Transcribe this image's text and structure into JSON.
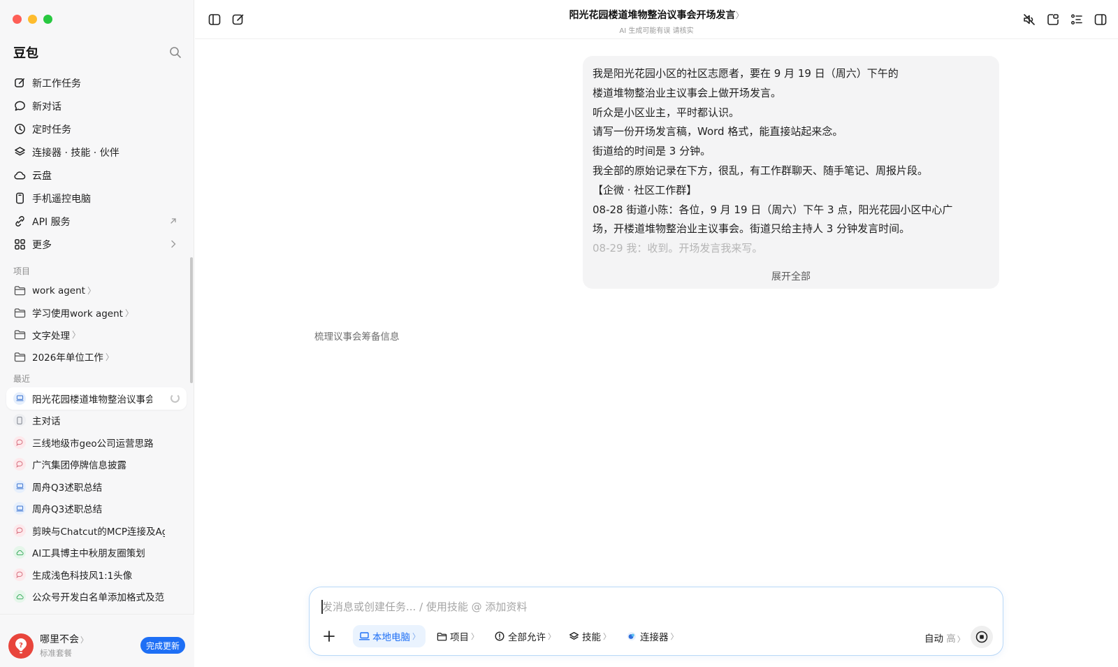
{
  "app": {
    "name": "豆包"
  },
  "sidebar": {
    "nav": [
      {
        "label": "新工作任务",
        "icon": "edit-icon"
      },
      {
        "label": "新对话",
        "icon": "chat-bubble-icon"
      },
      {
        "label": "定时任务",
        "icon": "clock-icon"
      },
      {
        "label": "连接器 · 技能 · 伙伴",
        "icon": "layers-icon"
      },
      {
        "label": "云盘",
        "icon": "cloud-icon"
      },
      {
        "label": "手机遥控电脑",
        "icon": "phone-icon"
      },
      {
        "label": "API 服务",
        "icon": "api-icon",
        "trail": "external-arrow-icon"
      },
      {
        "label": "更多",
        "icon": "grid-icon",
        "trail": "chevron-right-icon"
      }
    ],
    "projects_label": "项目",
    "projects": [
      "work agent",
      "学习使用work agent",
      "文字处理",
      "2026年单位工作"
    ],
    "recent_label": "最近",
    "recent": [
      {
        "label": "阳光花园楼道堆物整治议事会",
        "kind": "computer",
        "active": true
      },
      {
        "label": "主对话",
        "kind": "phone"
      },
      {
        "label": "三线地级市geo公司运营思路",
        "kind": "chat"
      },
      {
        "label": "广汽集团停牌信息披露",
        "kind": "chat"
      },
      {
        "label": "周舟Q3述职总结",
        "kind": "computer"
      },
      {
        "label": "周舟Q3述职总结",
        "kind": "computer"
      },
      {
        "label": "剪映与Chatcut的MCP连接及Ag",
        "kind": "chat"
      },
      {
        "label": "AI工具博主中秋朋友圈策划",
        "kind": "cloud"
      },
      {
        "label": "生成浅色科技风1:1头像",
        "kind": "chat"
      },
      {
        "label": "公众号开发白名单添加格式及范",
        "kind": "cloud"
      }
    ],
    "user": {
      "name": "哪里不会",
      "plan": "标准套餐",
      "update_label": "完成更新"
    }
  },
  "header": {
    "title": "阳光花园楼道堆物整治议事会开场发言",
    "subtitle": "AI 生成可能有误 请核实"
  },
  "message": {
    "lines": [
      "我是阳光花园小区的社区志愿者，要在 9 月 19 日（周六）下午的",
      "楼道堆物整治业主议事会上做开场发言。",
      "听众是小区业主，平时都认识。",
      "请写一份开场发言稿，Word 格式，能直接站起来念。",
      "街道给的时间是 3 分钟。",
      "我全部的原始记录在下方，很乱，有工作群聊天、随手笔记、周报片段。",
      "【企微 · 社区工作群】",
      "08-28 街道小陈：各位，9 月 19 日（周六）下午 3 点，阳光花园小区中心广",
      "场，开楼道堆物整治业主议事会。街道只给主持人 3 分钟发言时间。",
      "08-29 我：收到。开场发言我来写。"
    ],
    "expand_label": "展开全部"
  },
  "status_text": "梳理议事会筹备信息",
  "composer": {
    "placeholder": "发消息或创建任务... / 使用技能 @ 添加资料",
    "tools": [
      {
        "label": "本地电脑",
        "icon": "laptop-icon"
      },
      {
        "label": "项目",
        "icon": "folder-icon"
      },
      {
        "label": "全部允许",
        "icon": "alert-circle-icon"
      },
      {
        "label": "技能",
        "icon": "layers-icon"
      },
      {
        "label": "连接器",
        "icon": "connector-icon"
      }
    ],
    "mode_label": "自动",
    "mode_level": "高"
  },
  "colors": {
    "accent": "#1e6ff5",
    "close": "#fe5f57",
    "minimize": "#febc2e",
    "zoom": "#28c840"
  }
}
